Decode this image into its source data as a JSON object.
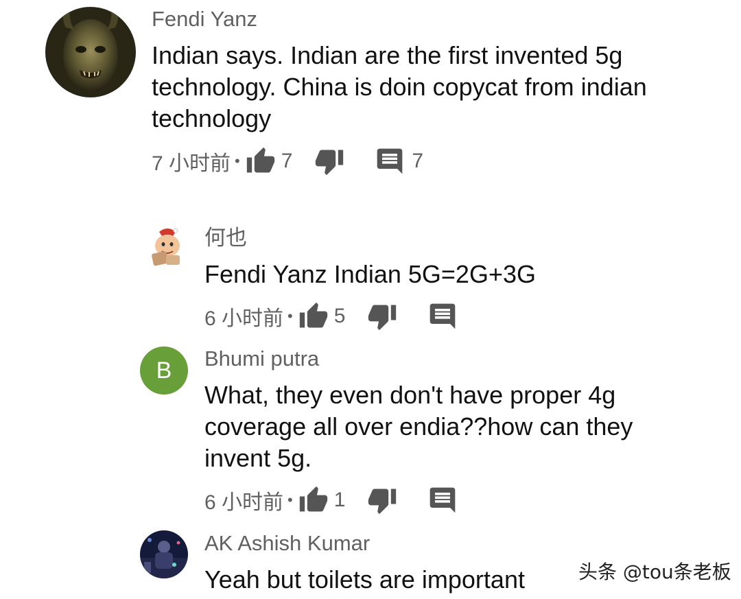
{
  "comments": [
    {
      "author": "Fendi Yanz",
      "text": "Indian says. Indian are the first invented 5g technology. China is doin copycat from indian technology",
      "time": "7 小时前",
      "dot": "•",
      "likes": "7",
      "replies": "7",
      "avatar_icon": "demon-face-avatar"
    },
    {
      "author": "何也",
      "text": "Fendi Yanz Indian 5G=2G+3G",
      "time": "6 小时前",
      "dot": "•",
      "likes": "5",
      "avatar_icon": "cartoon-character-avatar"
    },
    {
      "author": "Bhumi putra",
      "text": "What, they even don't have proper 4g coverage all over endia??how can they invent 5g.",
      "time": "6 小时前",
      "dot": "•",
      "likes": "1",
      "avatar_letter": "B",
      "avatar_color": "#689F38"
    },
    {
      "author": "AK Ashish Kumar",
      "text": "Yeah but toilets are important",
      "avatar_icon": "photo-avatar"
    }
  ],
  "watermark": "头条 @tou条老板",
  "colors": {
    "meta_gray": "#606060",
    "icon_dark": "#555555"
  }
}
